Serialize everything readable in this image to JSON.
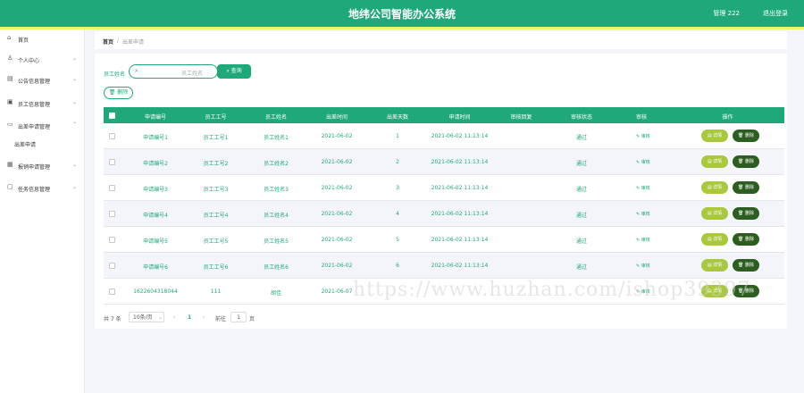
{
  "header": {
    "title": "地纬公司智能办公系统",
    "user": "管理 222",
    "logout": "退出登录"
  },
  "sidebar": {
    "items": [
      {
        "label": "首页",
        "icon": "home-icon",
        "expandable": false
      },
      {
        "label": "个人中心",
        "icon": "user-icon",
        "expandable": true
      },
      {
        "label": "公告信息管理",
        "icon": "notice-icon",
        "expandable": true
      },
      {
        "label": "员工信息管理",
        "icon": "people-icon",
        "expandable": true
      },
      {
        "label": "出差申请管理",
        "icon": "trip-icon",
        "expandable": true,
        "expanded": true
      },
      {
        "label": "报销申请管理",
        "icon": "invoice-icon",
        "expandable": true
      },
      {
        "label": "任务信息管理",
        "icon": "task-icon",
        "expandable": true
      }
    ],
    "sub_item": "出差申请"
  },
  "breadcrumb": {
    "home": "首页",
    "separator": "/",
    "current": "出差申请"
  },
  "search": {
    "label": "员工姓名",
    "placeholder": "员工姓名",
    "button": "查询"
  },
  "toolbar": {
    "delete": "删除"
  },
  "table": {
    "headers": [
      "申请编号",
      "员工工号",
      "员工姓名",
      "出差时间",
      "出差天数",
      "申请时间",
      "审核回复",
      "审核状态",
      "审核",
      "操作"
    ],
    "rows": [
      {
        "no": "申请编号1",
        "emp_no": "员工工号1",
        "name": "员工姓名1",
        "date": "2021-06-02",
        "days": "1",
        "apply_time": "2021-06-02 11:13:14",
        "reply": "",
        "status": "通过",
        "audit": "审核",
        "detail": "详情",
        "delete": "删除"
      },
      {
        "no": "申请编号2",
        "emp_no": "员工工号2",
        "name": "员工姓名2",
        "date": "2021-06-02",
        "days": "2",
        "apply_time": "2021-06-02 11:13:14",
        "reply": "",
        "status": "通过",
        "audit": "审核",
        "detail": "详情",
        "delete": "删除"
      },
      {
        "no": "申请编号3",
        "emp_no": "员工工号3",
        "name": "员工姓名3",
        "date": "2021-06-02",
        "days": "3",
        "apply_time": "2021-06-02 11:13:14",
        "reply": "",
        "status": "通过",
        "audit": "审核",
        "detail": "详情",
        "delete": "删除"
      },
      {
        "no": "申请编号4",
        "emp_no": "员工工号4",
        "name": "员工姓名4",
        "date": "2021-06-02",
        "days": "4",
        "apply_time": "2021-06-02 11:13:14",
        "reply": "",
        "status": "通过",
        "audit": "审核",
        "detail": "详情",
        "delete": "删除"
      },
      {
        "no": "申请编号5",
        "emp_no": "员工工号5",
        "name": "员工姓名5",
        "date": "2021-06-02",
        "days": "5",
        "apply_time": "2021-06-02 11:13:14",
        "reply": "",
        "status": "通过",
        "audit": "审核",
        "detail": "详情",
        "delete": "删除"
      },
      {
        "no": "申请编号6",
        "emp_no": "员工工号6",
        "name": "员工姓名6",
        "date": "2021-06-02",
        "days": "6",
        "apply_time": "2021-06-02 11:13:14",
        "reply": "",
        "status": "通过",
        "audit": "审核",
        "detail": "详情",
        "delete": "删除"
      },
      {
        "no": "1622604318044",
        "emp_no": "111",
        "name": "胡佳",
        "date": "2021-06-07",
        "days": "",
        "apply_time": "",
        "reply": "",
        "status": "",
        "audit": "审核",
        "detail": "详情",
        "delete": "删除"
      }
    ]
  },
  "pagination": {
    "total": "共 7 条",
    "page_size": "10条/页",
    "prev": "‹",
    "current": "1",
    "next": "›",
    "goto_label": "前往",
    "goto_value": "1",
    "page_suffix": "页"
  },
  "watermark": "https://www.huzhan.com/ishop39397",
  "colors": {
    "primary": "#1fa97a",
    "accent_bar": "#e6f66a",
    "detail": "#a7c93b",
    "delete": "#2c5f1f"
  }
}
